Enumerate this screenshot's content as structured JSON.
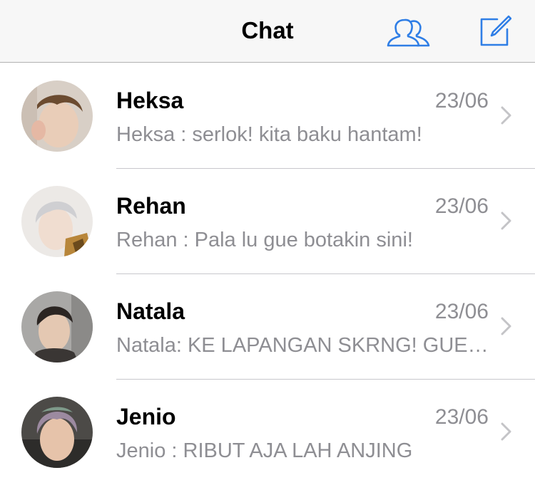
{
  "nav": {
    "title": "Chat",
    "contacts_icon": "contacts-icon",
    "compose_icon": "compose-icon",
    "accent": "#2f7ee6"
  },
  "chats": [
    {
      "name": "Heksa",
      "time": "23/06",
      "preview": "Heksa : serlok! kita baku hantam!"
    },
    {
      "name": "Rehan",
      "time": "23/06",
      "preview": "Rehan : Pala lu gue botakin sini!"
    },
    {
      "name": "Natala",
      "time": "23/06",
      "preview": "Natala: KE LAPANGAN SKRNG! GUE TUNGGU"
    },
    {
      "name": "Jenio",
      "time": "23/06",
      "preview": "Jenio : RIBUT AJA LAH ANJING"
    }
  ]
}
